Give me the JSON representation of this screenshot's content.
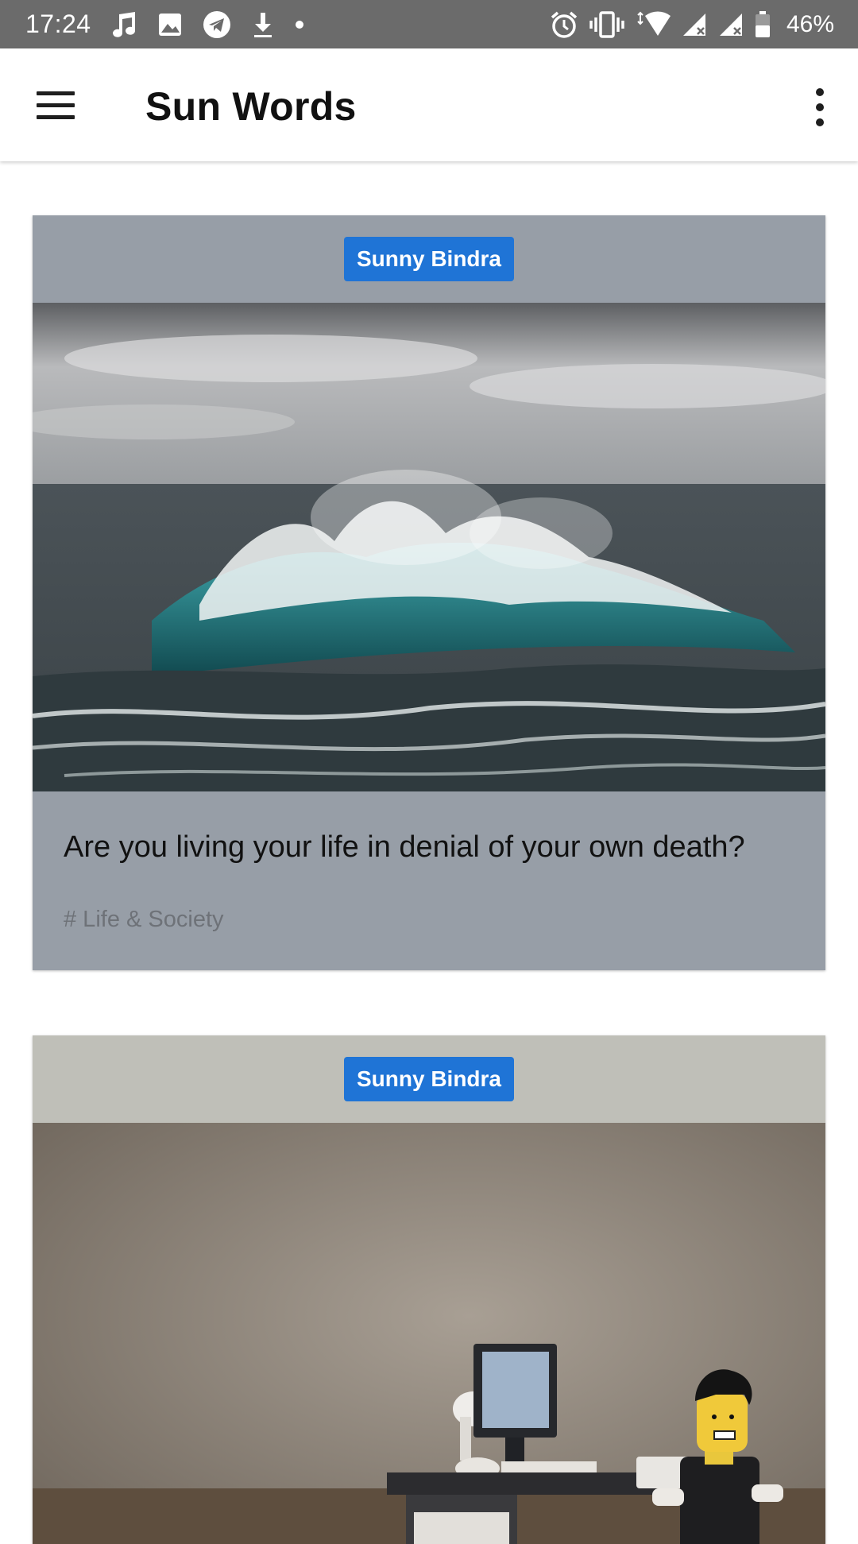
{
  "status_bar": {
    "time": "17:24",
    "battery": "46%",
    "left_icons": [
      "music-note-icon",
      "image-icon",
      "telegram-icon",
      "download-icon",
      "dot-icon"
    ],
    "right_icons": [
      "alarm-icon",
      "vibrate-icon",
      "wifi-icon",
      "signal-icon",
      "signal-icon",
      "battery-icon"
    ]
  },
  "app_bar": {
    "title": "Sun Words",
    "menu_icon": "hamburger-menu-icon",
    "overflow_icon": "more-vert-icon"
  },
  "posts": [
    {
      "author": "Sunny Bindra",
      "image": "ocean-wave-photo",
      "title": "Are you living your life in denial of your own death?",
      "tag": "# Life & Society"
    },
    {
      "author": "Sunny Bindra",
      "image": "lego-office-worker-photo"
    }
  ],
  "colors": {
    "status_bar": "#6b6b6b",
    "author_chip": "#1f74d6",
    "card1_bg": "#979ea7",
    "card2_bg": "#bfbfb8"
  }
}
